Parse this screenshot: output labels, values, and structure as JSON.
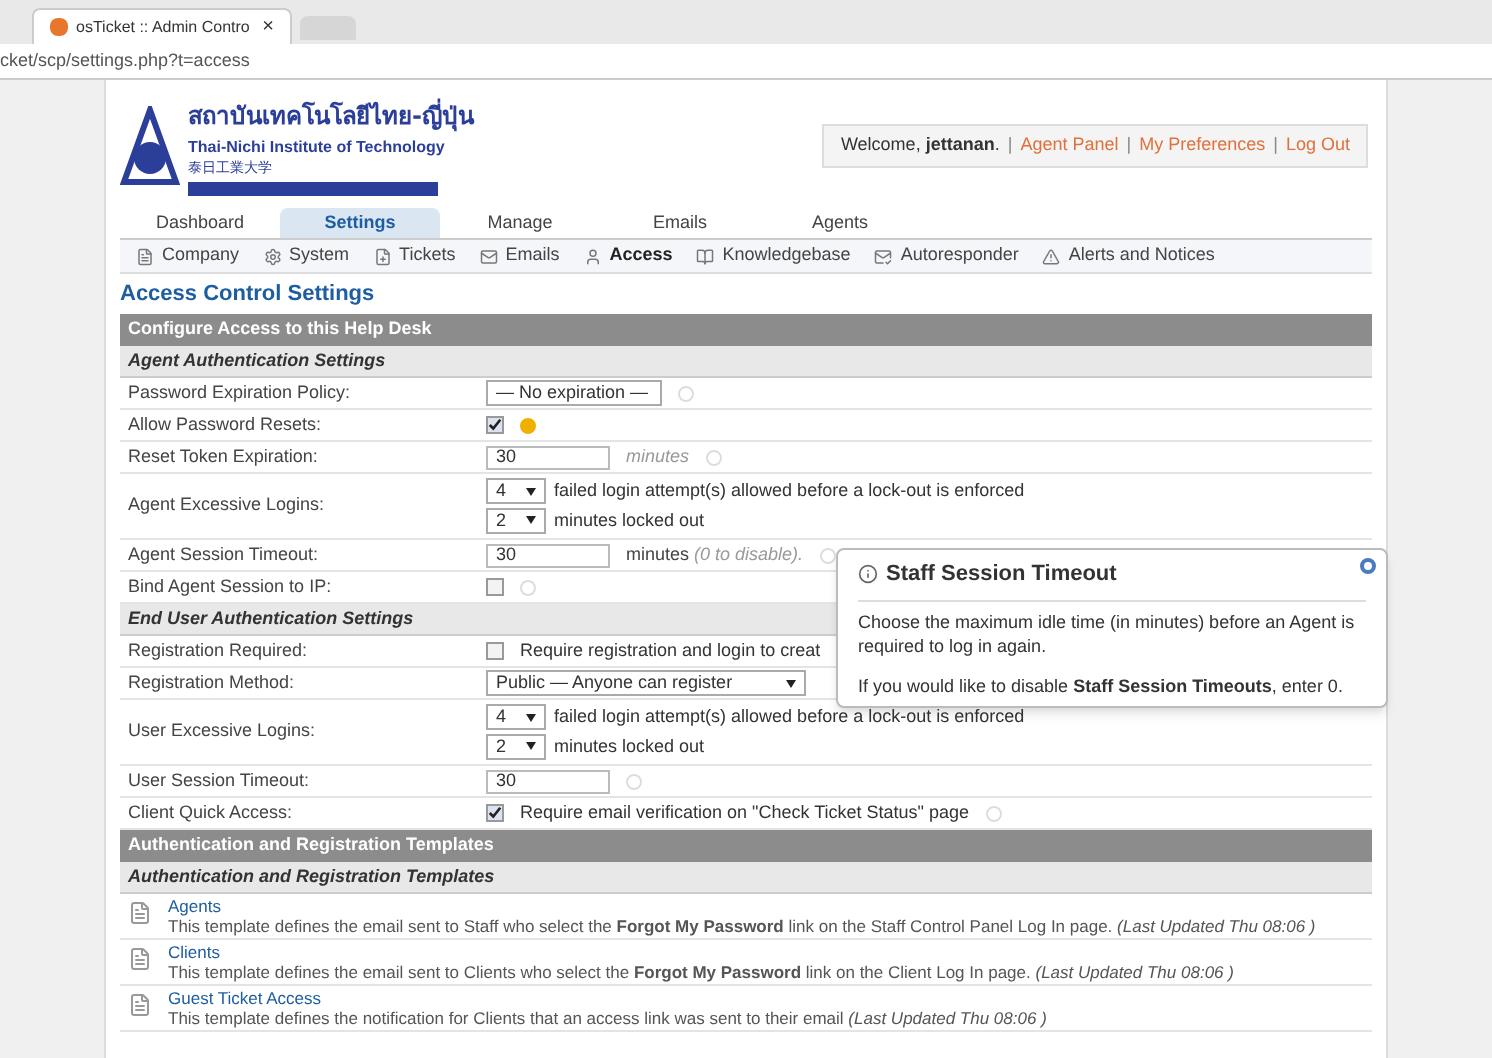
{
  "browser": {
    "tab_title": "osTicket :: Admin Contro",
    "tab_close": "×",
    "url": "cket/scp/settings.php?t=access"
  },
  "header": {
    "logo_thai": "สถาบันเทคโนโลยีไทย-ญี่ปุ่น",
    "logo_english": "Thai-Nichi Institute of Technology",
    "logo_japanese": "泰日工業大学",
    "welcome": "Welcome, **jettanan**.",
    "separator": "|",
    "links": [
      "Agent Panel",
      "My Preferences",
      "Log Out"
    ]
  },
  "nav": {
    "tabs": [
      {
        "label": "Dashboard",
        "selected": false
      },
      {
        "label": "Settings",
        "selected": true
      },
      {
        "label": "Manage",
        "selected": false
      },
      {
        "label": "Emails",
        "selected": false
      },
      {
        "label": "Agents",
        "selected": false
      }
    ],
    "subnav": [
      {
        "label": "Company",
        "selected": false
      },
      {
        "label": "System",
        "selected": false
      },
      {
        "label": "Tickets",
        "selected": false
      },
      {
        "label": "Emails",
        "selected": false
      },
      {
        "label": "Access",
        "selected": true
      },
      {
        "label": "Knowledgebase",
        "selected": false
      },
      {
        "label": "Autoresponder",
        "selected": false
      },
      {
        "label": "Alerts and Notices",
        "selected": false
      }
    ]
  },
  "page_title": "Access Control Settings",
  "rows": [
    {
      "kind": "header",
      "label": "Configure Access to this Help Desk"
    },
    {
      "kind": "subheader",
      "label": "Agent Authentication Settings"
    },
    {
      "kind": "select",
      "label": "Password Expiration Policy:",
      "value": "— No expiration —"
    },
    {
      "kind": "checkbox",
      "label": "Allow Password Resets:",
      "checked": true,
      "warning": true
    },
    {
      "kind": "input",
      "label": "Reset Token Expiration:",
      "value": "30",
      "suffix": "minutes",
      "suffix_italic": true
    },
    {
      "kind": "logins",
      "label": "Agent Excessive Logins:",
      "attempts": "4",
      "attempts_text": "failed login attempt(s) allowed before a lock-out is enforced",
      "minutes": "2",
      "minutes_text": "minutes locked out"
    },
    {
      "kind": "input",
      "label": "Agent Session Timeout:",
      "value": "30",
      "suffix": "minutes",
      "note": "(0 to disable)."
    },
    {
      "kind": "checkbox",
      "label": "Bind Agent Session to IP:",
      "checked": false,
      "warning": false
    },
    {
      "kind": "subheader",
      "label": "End User Authentication Settings"
    },
    {
      "kind": "checkbox",
      "label": "Registration Required:",
      "checked": false,
      "text": "Require registration and login to creat"
    },
    {
      "kind": "select",
      "label": "Registration Method:",
      "value": "Public — Anyone can register",
      "wide": true
    },
    {
      "kind": "logins",
      "label": "User Excessive Logins:",
      "attempts": "4",
      "attempts_text": "failed login attempt(s) allowed before a lock-out is enforced",
      "minutes": "2",
      "minutes_text": "minutes locked out"
    },
    {
      "kind": "input",
      "label": "User Session Timeout:",
      "value": "30"
    },
    {
      "kind": "checkbox",
      "label": "Client Quick Access:",
      "checked": true,
      "warning": false,
      "text": "Require email verification on \"Check Ticket Status\" page"
    },
    {
      "kind": "header",
      "label": "Authentication and Registration Templates"
    },
    {
      "kind": "subheader",
      "label": "Authentication and Registration Templates"
    },
    {
      "kind": "template",
      "label": "Agents",
      "text": "This template defines the email sent to Staff who select the **Forgot My Password** link on the Staff Control Panel Log In page. *(Last Updated Thu 08:06 )*"
    },
    {
      "kind": "template",
      "label": "Clients",
      "text": "This template defines the email sent to Clients who select the **Forgot My Password** link on the Client Log In page. *(Last Updated Thu 08:06 )*"
    },
    {
      "kind": "template",
      "label": "Guest Ticket Access",
      "text": "This template defines the notification for Clients that an access link was sent to their email *(Last Updated Thu 08:06 )*"
    }
  ],
  "tooltip": {
    "title": "Staff Session Timeout",
    "paragraphs": [
      "Choose the maximum idle time (in minutes) before an Agent is required to log in again.",
      "If you would like to disable **Staff Session Timeouts**, enter 0."
    ]
  }
}
